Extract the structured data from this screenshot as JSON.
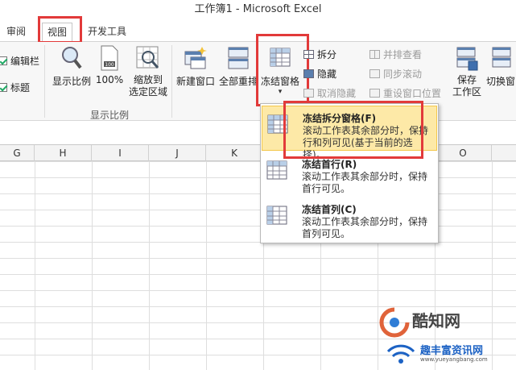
{
  "window": {
    "title": "工作簿1  -  Microsoft Excel"
  },
  "tabs": [
    "审阅",
    "视图",
    "开发工具"
  ],
  "ribbon": {
    "show": {
      "formula_bar": "编辑栏",
      "headings": "标题"
    },
    "zoom": {
      "zoom_btn": "显示比例",
      "hundred_btn": "100%",
      "zoom_sel_line1": "缩放到",
      "zoom_sel_line2": "选定区域",
      "group_label": "显示比例"
    },
    "window": {
      "new_window": "新建窗口",
      "arrange_all": "全部重排",
      "freeze_panes": "冻结窗格",
      "split": "拆分",
      "hide": "隐藏",
      "unhide": "取消隐藏",
      "side_by_side": "并排查看",
      "sync_scroll": "同步滚动",
      "reset_pos": "重设窗口位置",
      "save_ws_line1": "保存",
      "save_ws_line2": "工作区",
      "switch_line1": "切换窗"
    }
  },
  "columns": [
    "G",
    "H",
    "I",
    "J",
    "K",
    "O"
  ],
  "freeze_menu": [
    {
      "title": "冻结拆分窗格(F)",
      "desc": "滚动工作表其余部分时，保持行和列可见(基于当前的选择)。"
    },
    {
      "title": "冻结首行(R)",
      "desc": "滚动工作表其余部分时，保持首行可见。"
    },
    {
      "title": "冻结首列(C)",
      "desc": "滚动工作表其余部分时，保持首列可见。"
    }
  ],
  "watermark": {
    "line1": "酷知网",
    "line2": "趣丰富资讯网",
    "line3": "www.yueyangbang.com"
  },
  "colors": {
    "highlight": "#fde9a7",
    "annotation_red": "#e23a3a"
  }
}
